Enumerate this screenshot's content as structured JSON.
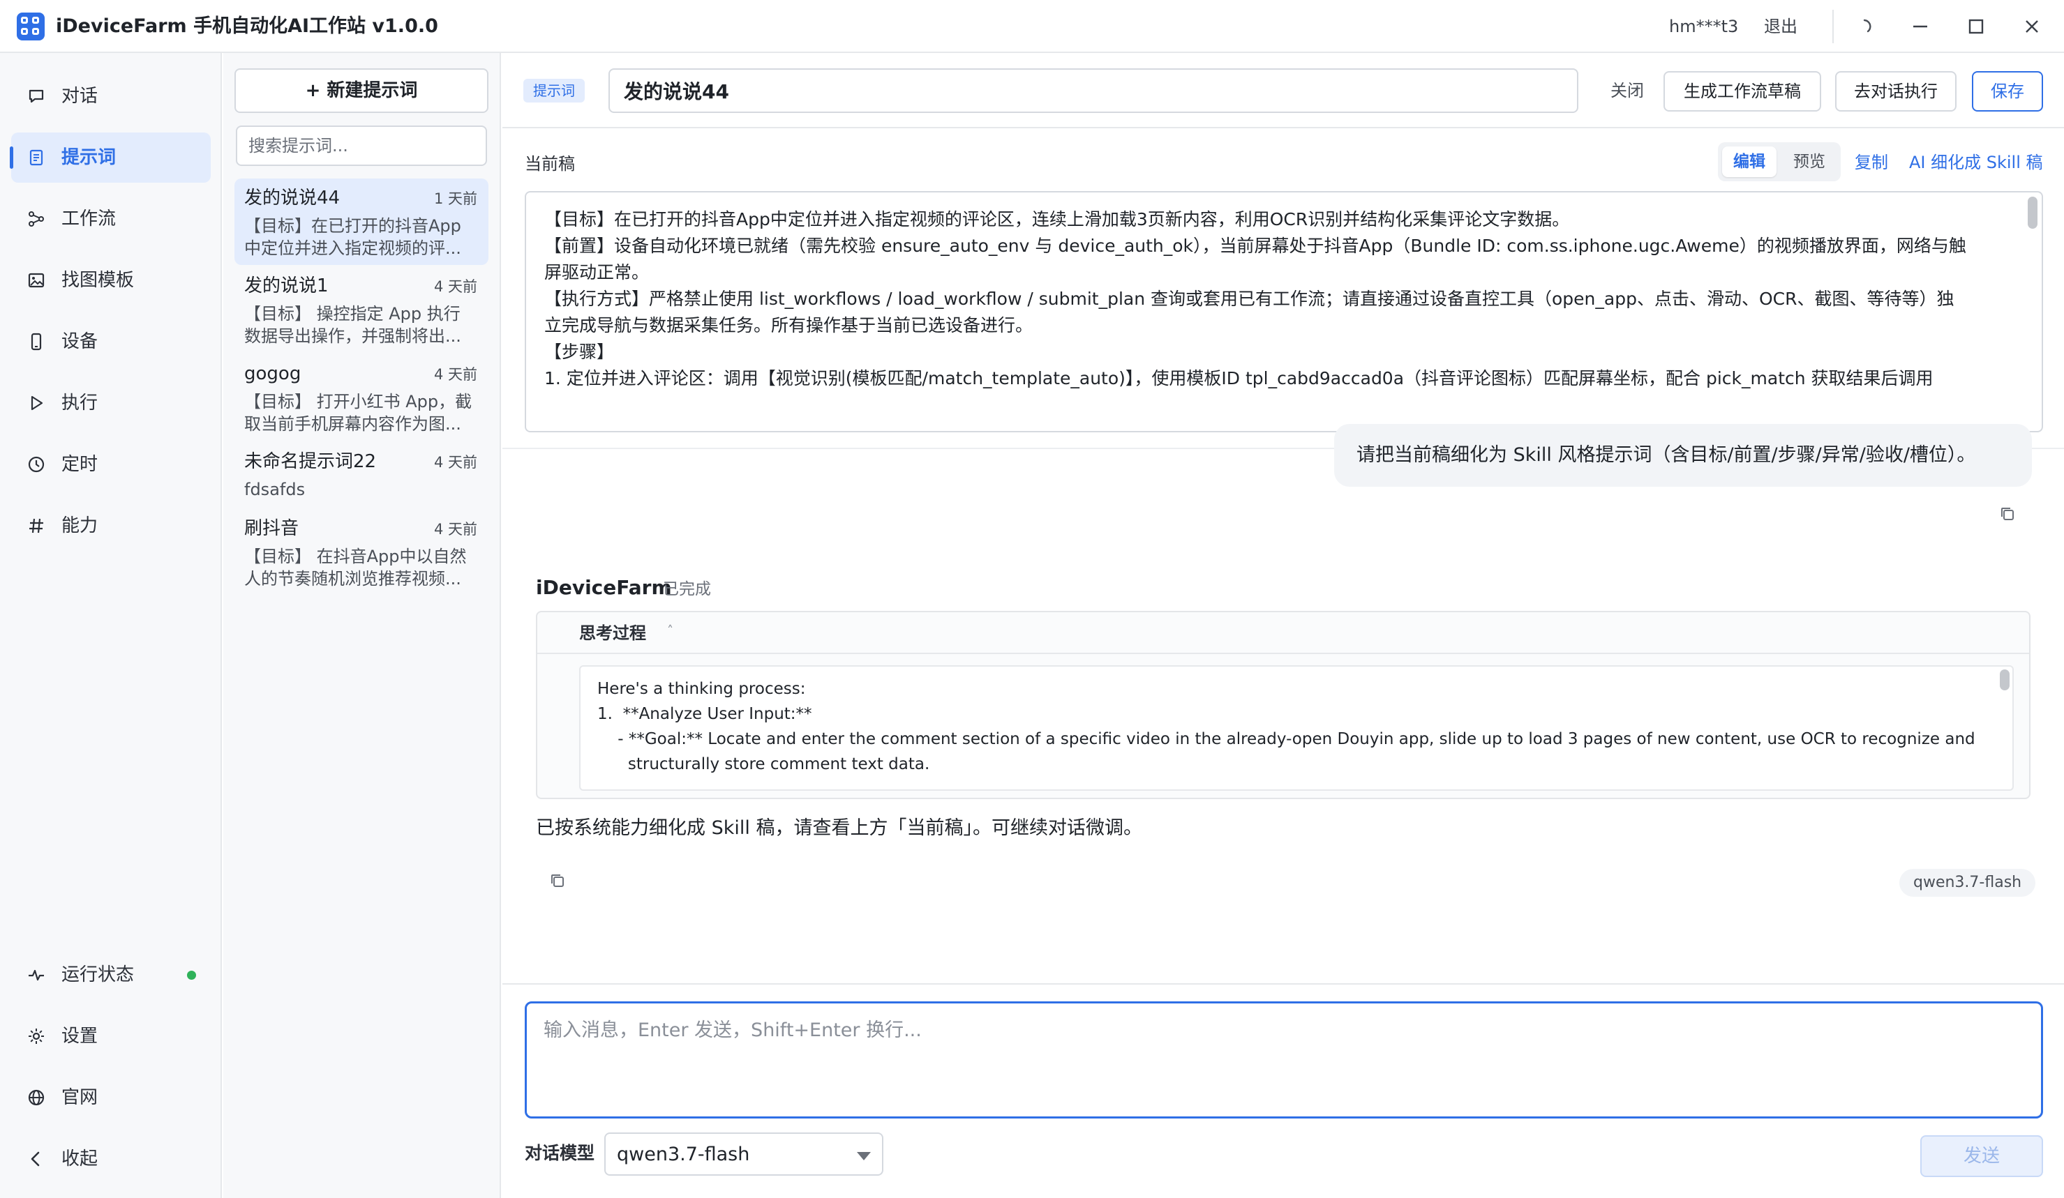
{
  "titlebar": {
    "title": "iDeviceFarm 手机自动化AI工作站 v1.0.0",
    "user": "hm***t3",
    "logout": "退出"
  },
  "nav": {
    "items": [
      {
        "label": "对话",
        "icon": "chat-bubble-icon"
      },
      {
        "label": "提示词",
        "icon": "document-icon",
        "active": true
      },
      {
        "label": "工作流",
        "icon": "workflow-icon"
      },
      {
        "label": "找图模板",
        "icon": "image-icon"
      },
      {
        "label": "设备",
        "icon": "phone-icon"
      },
      {
        "label": "执行",
        "icon": "play-icon"
      },
      {
        "label": "定时",
        "icon": "clock-icon"
      },
      {
        "label": "能力",
        "icon": "hash-icon"
      }
    ],
    "bottom": [
      {
        "label": "运行状态",
        "icon": "pulse-icon",
        "status_color": "#2fb25a"
      },
      {
        "label": "设置",
        "icon": "gear-icon"
      },
      {
        "label": "官网",
        "icon": "globe-icon"
      },
      {
        "label": "收起",
        "icon": "chevron-left-icon"
      }
    ]
  },
  "prompt_list": {
    "new_label": "+ 新建提示词",
    "search_placeholder": "搜索提示词...",
    "items": [
      {
        "title": "发的说说44",
        "time": "1 天前",
        "desc1": "【目标】在已打开的抖音App",
        "desc2": "中定位并进入指定视频的评...",
        "active": true
      },
      {
        "title": "发的说说1",
        "time": "4 天前",
        "desc1": "【目标】 操控指定 App 执行",
        "desc2": "数据导出操作，并强制将出..."
      },
      {
        "title": "gogog",
        "time": "4 天前",
        "desc1": "【目标】 打开小红书 App，截",
        "desc2": "取当前手机屏幕内容作为图..."
      },
      {
        "title": "未命名提示词22",
        "time": "4 天前",
        "desc1": "fdsafds",
        "desc2": ""
      },
      {
        "title": "刷抖音",
        "time": "4 天前",
        "desc1": "【目标】 在抖音App中以自然",
        "desc2": "人的节奏随机浏览推荐视频..."
      }
    ]
  },
  "editor": {
    "tag": "提示词",
    "title_value": "发的说说44",
    "close": "关闭",
    "gen_workflow": "生成工作流草稿",
    "to_chat": "去对话执行",
    "save": "保存",
    "draft_label": "当前稿",
    "tab_edit": "编辑",
    "tab_preview": "预览",
    "copy": "复制",
    "refine": "AI 细化成 Skill 稿",
    "draft_lines": [
      "【目标】在已打开的抖音App中定位并进入指定视频的评论区，连续上滑加载3页新内容，利用OCR识别并结构化采集评论文字数据。",
      "【前置】设备自动化环境已就绪（需先校验 ensure_auto_env 与 device_auth_ok），当前屏幕处于抖音App（Bundle ID: com.ss.iphone.ugc.Aweme）的视频播放界面，网络与触",
      "屏驱动正常。",
      "【执行方式】严格禁止使用 list_workflows / load_workflow / submit_plan 查询或套用已有工作流；请直接通过设备直控工具（open_app、点击、滑动、OCR、截图、等待等）独",
      "立完成导航与数据采集任务。所有操作基于当前已选设备进行。",
      "【步骤】",
      "1. 定位并进入评论区：调用【视觉识别(模板匹配/match_template_auto)】，使用模板ID tpl_cabd9accad0a（抖音评论图标）匹配屏幕坐标，配合 pick_match 获取结果后调用"
    ]
  },
  "chat": {
    "user_message": "请把当前稿细化为 Skill 风格提示词（含目标/前置/步骤/异常/验收/槽位）。",
    "bot_name": "iDeviceFarm",
    "bot_status": "已完成",
    "think_title": "思考过程",
    "think_marker": "˄",
    "think_lines": [
      "Here's a thinking process:",
      "",
      "1.  **Analyze User Input:**",
      "    - **Goal:** Locate and enter the comment section of a specific video in the already-open Douyin app, slide up to load 3 pages of new content, use OCR to recognize and",
      "      structurally store comment text data."
    ],
    "bot_reply": "已按系统能力细化成 Skill 稿，请查看上方「当前稿」。可继续对话微调。",
    "model_chip": "qwen3.7-flash"
  },
  "composer": {
    "placeholder": "输入消息，Enter 发送，Shift+Enter 换行...",
    "model_label": "对话模型",
    "model_value": "qwen3.7-flash",
    "send": "发送"
  },
  "colors": {
    "accent": "#2f6fe6",
    "active_bg": "#e3ecfd",
    "status_ok": "#2fb25a"
  }
}
